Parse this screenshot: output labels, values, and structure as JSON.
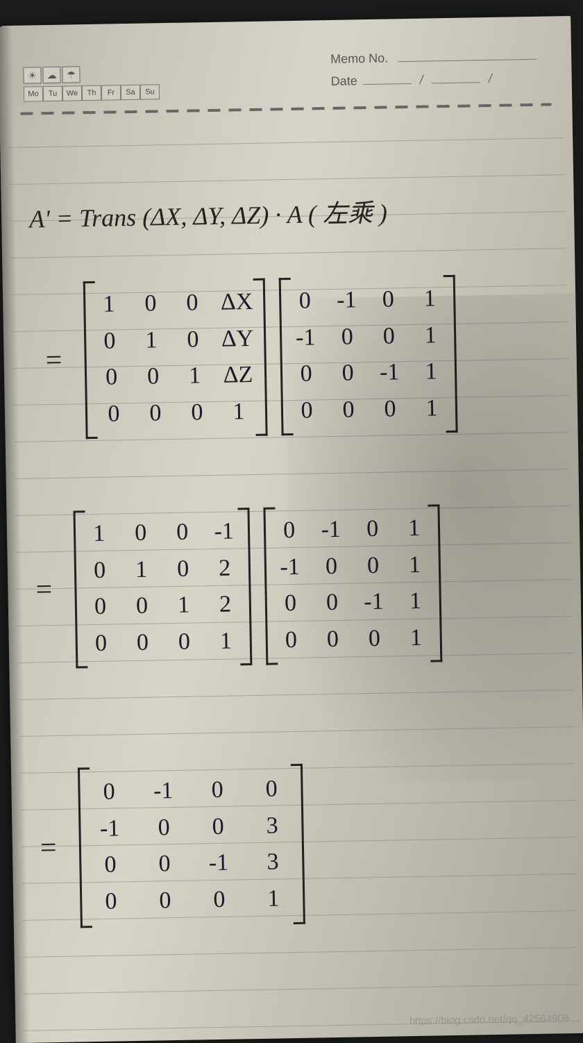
{
  "header": {
    "memo_label": "Memo No.",
    "date_label": "Date",
    "days": [
      "Mo",
      "Tu",
      "We",
      "Th",
      "Fr",
      "Sa",
      "Su"
    ],
    "weather_icons": [
      "☀",
      "☁",
      "☂"
    ]
  },
  "equation_line": "A' = Trans (ΔX, ΔY, ΔZ) · A  ( 左乘 )",
  "step1": {
    "left_matrix": [
      [
        "1",
        "0",
        "0",
        "ΔX"
      ],
      [
        "0",
        "1",
        "0",
        "ΔY"
      ],
      [
        "0",
        "0",
        "1",
        "ΔZ"
      ],
      [
        "0",
        "0",
        "0",
        "1"
      ]
    ],
    "right_matrix": [
      [
        "0",
        "-1",
        "0",
        "1"
      ],
      [
        "-1",
        "0",
        "0",
        "1"
      ],
      [
        "0",
        "0",
        "-1",
        "1"
      ],
      [
        "0",
        "0",
        "0",
        "1"
      ]
    ]
  },
  "step2": {
    "left_matrix": [
      [
        "1",
        "0",
        "0",
        "-1"
      ],
      [
        "0",
        "1",
        "0",
        "2"
      ],
      [
        "0",
        "0",
        "1",
        "2"
      ],
      [
        "0",
        "0",
        "0",
        "1"
      ]
    ],
    "right_matrix": [
      [
        "0",
        "-1",
        "0",
        "1"
      ],
      [
        "-1",
        "0",
        "0",
        "1"
      ],
      [
        "0",
        "0",
        "-1",
        "1"
      ],
      [
        "0",
        "0",
        "0",
        "1"
      ]
    ]
  },
  "result_matrix": [
    [
      "0",
      "-1",
      "0",
      "0"
    ],
    [
      "-1",
      "0",
      "0",
      "3"
    ],
    [
      "0",
      "0",
      "-1",
      "3"
    ],
    [
      "0",
      "0",
      "0",
      "1"
    ]
  ],
  "watermark": "https://blog.csdn.net/qq_42564908"
}
